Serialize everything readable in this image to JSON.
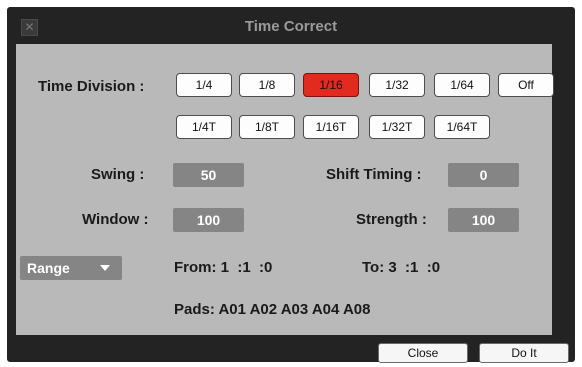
{
  "window": {
    "title": "Time Correct",
    "close_icon": "close-icon"
  },
  "time_division": {
    "label": "Time Division :",
    "row1": [
      "1/4",
      "1/8",
      "1/16",
      "1/32",
      "1/64",
      "Off"
    ],
    "row2": [
      "1/4T",
      "1/8T",
      "1/16T",
      "1/32T",
      "1/64T"
    ],
    "selected": "1/16"
  },
  "swing": {
    "label": "Swing :",
    "value": "50"
  },
  "shift_timing": {
    "label": "Shift Timing :",
    "value": "0"
  },
  "window_field": {
    "label": "Window :",
    "value": "100"
  },
  "strength": {
    "label": "Strength :",
    "value": "100"
  },
  "range_select": {
    "value": "Range"
  },
  "from": "From: 1  :1  :0",
  "to": "To: 3  :1  :0",
  "pads": "Pads: A01 A02 A03 A04 A08",
  "buttons": {
    "close": "Close",
    "do_it": "Do It"
  },
  "colors": {
    "selected": "#e32a1e",
    "panel": "#b9b9b9",
    "value_box": "#858585",
    "window_bg": "#232323"
  }
}
